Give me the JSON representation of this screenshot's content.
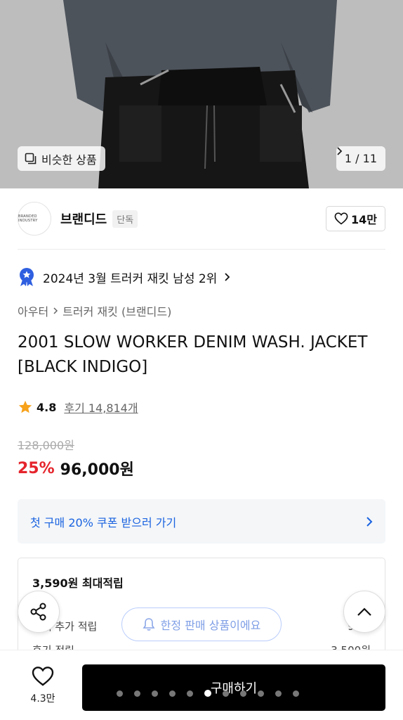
{
  "hero": {
    "similar_label": "비슷한 상품",
    "counter": "1 / 11"
  },
  "brand": {
    "logo_text": "BRANDED INDUSTRY",
    "name": "브랜디드",
    "tag": "단독",
    "likes": "14만"
  },
  "ranking": {
    "text": "2024년 3월 트러커 재킷 남성 2위"
  },
  "breadcrumb": {
    "category": "아우터",
    "subcategory": "트러커 재킷 (브랜디드)"
  },
  "product": {
    "title": "2001 SLOW WORKER DENIM WASH. JACKET [BLACK INDIGO]",
    "rating": "4.8",
    "reviews": "후기 14,814개",
    "original_price": "128,000원",
    "discount": "25%",
    "price": "96,000원"
  },
  "coupon": {
    "label": "첫 구매 20% 쿠폰 받으러 가기"
  },
  "points": {
    "title": "3,590원 최대적립",
    "line1_label": "구매 추가 적립",
    "line1_value": "90원",
    "line2_label": "후기 적립",
    "line2_value": "3,500원"
  },
  "floating": {
    "limited_label": "한정 판매 상품이에요"
  },
  "bottom": {
    "wish_count": "4.3만",
    "buy_label": "구매하기"
  },
  "colors": {
    "discount": "#e5242c",
    "coupon_text": "#1a63e0",
    "rank_badge": "#2f5fe0",
    "star": "#f7a21b"
  }
}
